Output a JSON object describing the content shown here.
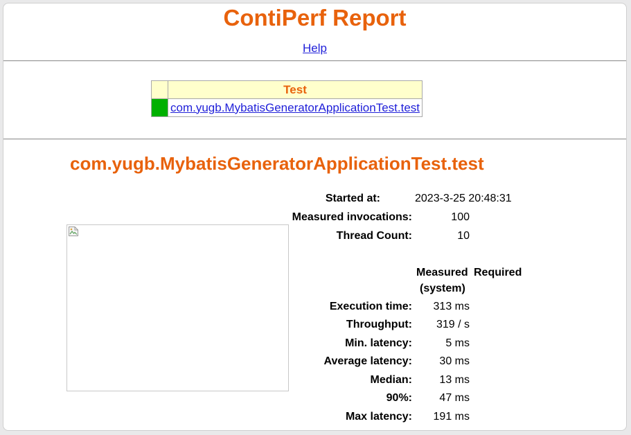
{
  "title": "ContiPerf Report",
  "help_link": "Help",
  "summary_table": {
    "header": "Test",
    "rows": [
      {
        "status_color": "#00b000",
        "name": "com.yugb.MybatisGeneratorApplicationTest.test"
      }
    ]
  },
  "detail": {
    "title": "com.yugb.MybatisGeneratorApplicationTest.test",
    "started_at_label": "Started at:",
    "started_at_value": "2023-3-25 20:48:31",
    "invocations_label": "Measured invocations:",
    "invocations_value": "100",
    "thread_count_label": "Thread Count:",
    "thread_count_value": "10",
    "col_measured_line1": "Measured",
    "col_measured_line2": "(system)",
    "col_required": "Required",
    "metrics": [
      {
        "label": "Execution time:",
        "measured": "313 ms",
        "required": ""
      },
      {
        "label": "Throughput:",
        "measured": "319 / s",
        "required": ""
      },
      {
        "label": "Min. latency:",
        "measured": "5 ms",
        "required": ""
      },
      {
        "label": "Average latency:",
        "measured": "30 ms",
        "required": ""
      },
      {
        "label": "Median:",
        "measured": "13 ms",
        "required": ""
      },
      {
        "label": "90%:",
        "measured": "47 ms",
        "required": ""
      },
      {
        "label": "Max latency:",
        "measured": "191 ms",
        "required": ""
      }
    ]
  },
  "colors": {
    "accent": "#e8620c",
    "link": "#2121d9",
    "table_header_bg": "#ffffcc",
    "status_pass": "#00b000"
  },
  "icons": {
    "chart_placeholder": "broken-image-icon"
  }
}
